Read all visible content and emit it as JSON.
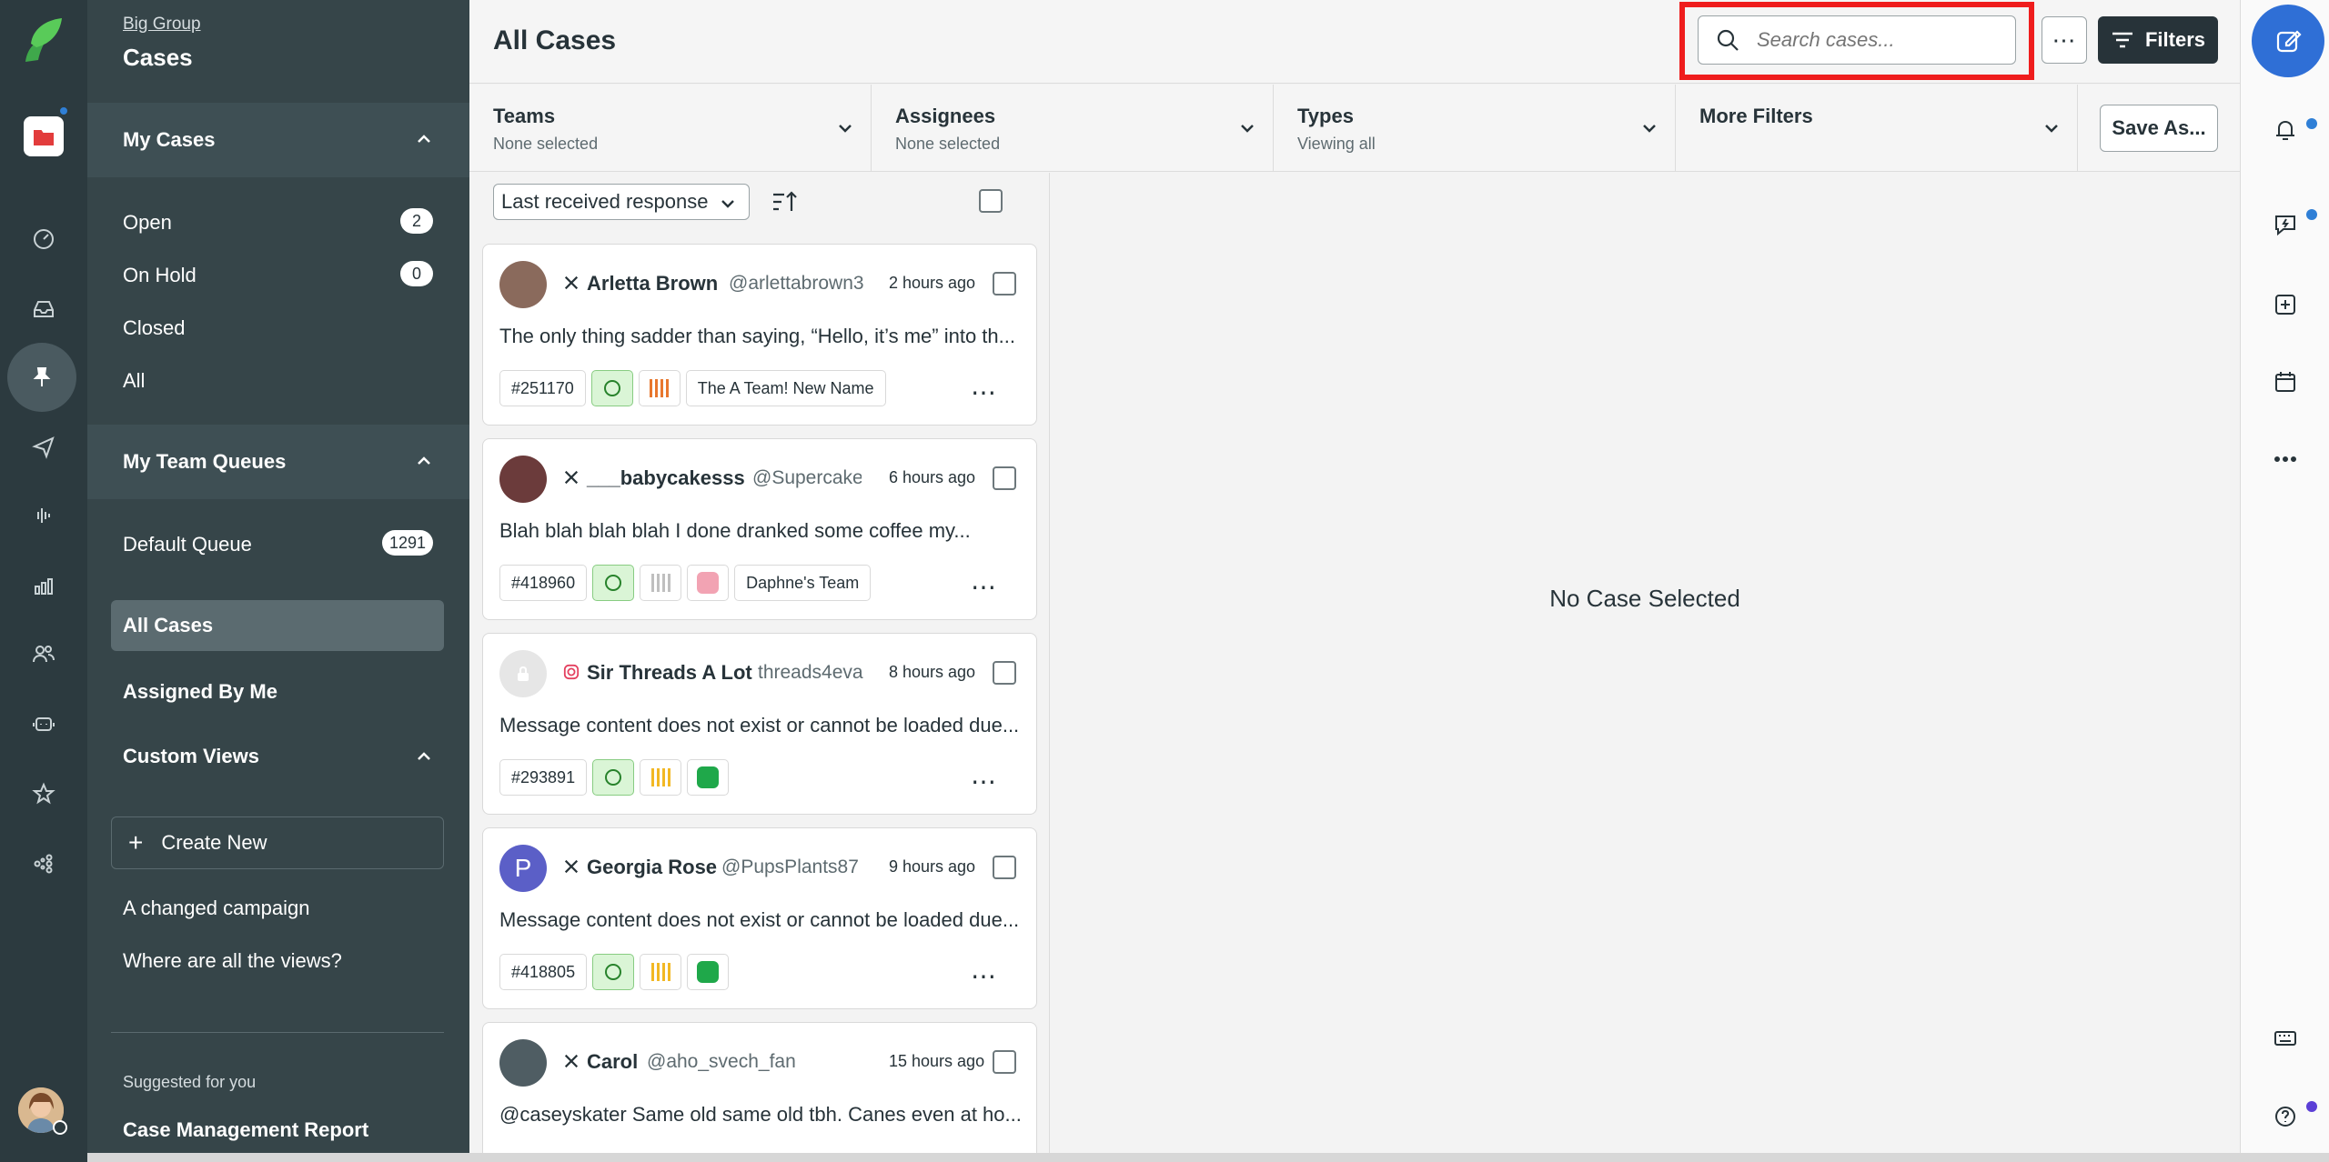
{
  "sidebar": {
    "breadcrumb": "Big Group",
    "title": "Cases",
    "my_cases": {
      "label": "My Cases",
      "items": [
        {
          "label": "Open",
          "count": "2"
        },
        {
          "label": "On Hold",
          "count": "0"
        },
        {
          "label": "Closed",
          "count": null
        },
        {
          "label": "All",
          "count": null
        }
      ]
    },
    "team_queues": {
      "label": "My Team Queues",
      "items": [
        {
          "label": "Default Queue",
          "count": "1291"
        }
      ]
    },
    "all_cases": "All Cases",
    "assigned_by_me": "Assigned By Me",
    "custom_views": {
      "label": "Custom Views",
      "create_new": "Create New",
      "items": [
        "A changed campaign",
        "Where are all the views?"
      ]
    },
    "suggested_label": "Suggested for you",
    "suggested_item": "Case Management Report"
  },
  "header": {
    "title": "All Cases",
    "search_placeholder": "Search cases...",
    "more_label": "⋯",
    "filters_label": "Filters"
  },
  "filters": [
    {
      "label": "Teams",
      "value": "None selected"
    },
    {
      "label": "Assignees",
      "value": "None selected"
    },
    {
      "label": "Types",
      "value": "Viewing all"
    },
    {
      "label": "More Filters",
      "value": ""
    }
  ],
  "save_as_label": "Save As...",
  "list": {
    "sort_value": "Last received response",
    "cases": [
      {
        "network": "X",
        "name": "Arletta Brown",
        "handle": "@arlettabrown3",
        "time": "2 hours ago",
        "message": "The only thing sadder than saying, “Hello, it’s me” into th...",
        "id": "#251170",
        "team": "The A Team! New Name",
        "avatar_color": "#8a6a5c",
        "avatar_letter": "",
        "prio_color": "#e8772e",
        "img_color": ""
      },
      {
        "network": "X",
        "name": "___babycakesss",
        "handle": "@Supercake",
        "time": "6 hours ago",
        "message": "Blah blah blah blah I done dranked some coffee my...",
        "id": "#418960",
        "team": "Daphne's Team",
        "avatar_color": "#6b3b3b",
        "avatar_letter": "",
        "prio_color": "#bfbfbf",
        "img_color": "#f2a3b3"
      },
      {
        "network": "IG",
        "name": "Sir Threads A Lot",
        "handle": "threads4eva",
        "time": "8 hours ago",
        "message": "Message content does not exist or cannot be loaded due...",
        "id": "#293891",
        "team": "",
        "avatar_color": "#e6e6e6",
        "avatar_letter": "",
        "prio_color": "#f2b824",
        "img_color": "#1fa84a"
      },
      {
        "network": "X",
        "name": "Georgia Rose",
        "handle": "@PupsPlants87",
        "time": "9 hours ago",
        "message": "Message content does not exist or cannot be loaded due...",
        "id": "#418805",
        "team": "",
        "avatar_color": "#5b5fc7",
        "avatar_letter": "P",
        "prio_color": "#f2b824",
        "img_color": "#1fa84a"
      },
      {
        "network": "X",
        "name": "Carol",
        "handle": "@aho_svech_fan",
        "time": "15 hours ago",
        "message": "@caseyskater Same old same old tbh. Canes even at ho...",
        "id": "",
        "team": "",
        "avatar_color": "#4f5d63",
        "avatar_letter": "",
        "prio_color": "",
        "img_color": ""
      }
    ]
  },
  "detail": {
    "empty_text": "No Case Selected"
  },
  "colors": {
    "brand": "#59cb59",
    "highlight": "#ef1d1d",
    "accent": "#2f6fd6"
  }
}
